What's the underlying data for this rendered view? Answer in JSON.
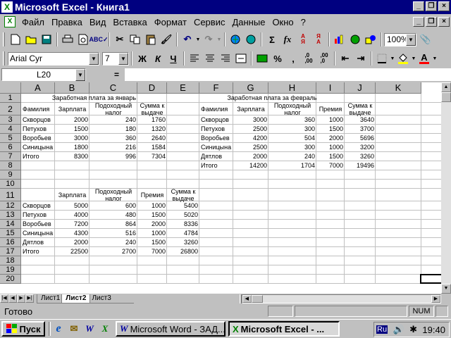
{
  "window": {
    "title": "Microsoft Excel - Книга1"
  },
  "menu": [
    "Файл",
    "Правка",
    "Вид",
    "Вставка",
    "Формат",
    "Сервис",
    "Данные",
    "Окно",
    "?"
  ],
  "formatting": {
    "font": "Arial Cyr",
    "size": "7",
    "bold": "Ж",
    "italic": "К",
    "underline": "Ч",
    "zoom": "100%"
  },
  "formula_bar": {
    "name_box": "L20",
    "equals": "=",
    "value": ""
  },
  "columns": [
    "A",
    "B",
    "C",
    "D",
    "E",
    "F",
    "G",
    "H",
    "I",
    "J",
    "K"
  ],
  "rows": [
    "1",
    "2",
    "3",
    "4",
    "5",
    "6",
    "7",
    "8",
    "9",
    "10",
    "11",
    "12",
    "13",
    "14",
    "15",
    "16",
    "17",
    "18",
    "19",
    "20"
  ],
  "table1": {
    "title": "Заработная плата за январь",
    "headers": [
      "Фамилия",
      "Зарплата",
      "Подоходный налог",
      "Сумма к выдаче"
    ],
    "rows": [
      [
        "Скворцов",
        "2000",
        "240",
        "1760"
      ],
      [
        "Петухов",
        "1500",
        "180",
        "1320"
      ],
      [
        "Воробьев",
        "3000",
        "360",
        "2640"
      ],
      [
        "Синицына",
        "1800",
        "216",
        "1584"
      ],
      [
        "Итого",
        "8300",
        "996",
        "7304"
      ]
    ]
  },
  "table2": {
    "title": "Заработная плата за февраль",
    "headers": [
      "Фамилия",
      "Зарплата",
      "Подоходный налог",
      "Премия",
      "Сумма к выдаче"
    ],
    "rows": [
      [
        "Скворцов",
        "3000",
        "360",
        "1000",
        "3640"
      ],
      [
        "Петухов",
        "2500",
        "300",
        "1500",
        "3700"
      ],
      [
        "Воробьев",
        "4200",
        "504",
        "2000",
        "5696"
      ],
      [
        "Синицына",
        "2500",
        "300",
        "1000",
        "3200"
      ],
      [
        "Дятлов",
        "2000",
        "240",
        "1500",
        "3260"
      ],
      [
        "Итого",
        "14200",
        "1704",
        "7000",
        "19496"
      ]
    ]
  },
  "table3": {
    "headers": [
      "Зарплата",
      "Подоходный налог",
      "Премия",
      "Сумма к выдаче"
    ],
    "rows": [
      [
        "Скворцов",
        "5000",
        "600",
        "1000",
        "5400"
      ],
      [
        "Петухов",
        "4000",
        "480",
        "1500",
        "5020"
      ],
      [
        "Воробьев",
        "7200",
        "864",
        "2000",
        "8336"
      ],
      [
        "Синицына",
        "4300",
        "516",
        "1000",
        "4784"
      ],
      [
        "Дятлов",
        "2000",
        "240",
        "1500",
        "3260"
      ],
      [
        "Итого",
        "22500",
        "2700",
        "7000",
        "26800"
      ]
    ]
  },
  "sheet_tabs": [
    "Лист1",
    "Лист2",
    "Лист3"
  ],
  "active_tab": 1,
  "status": {
    "text": "Готово",
    "num": "NUM"
  },
  "taskbar": {
    "start": "Пуск",
    "tasks": [
      "Microsoft Word - ЗАД...",
      "Microsoft Excel - ..."
    ],
    "lang": "Ru",
    "time": "19:40"
  }
}
